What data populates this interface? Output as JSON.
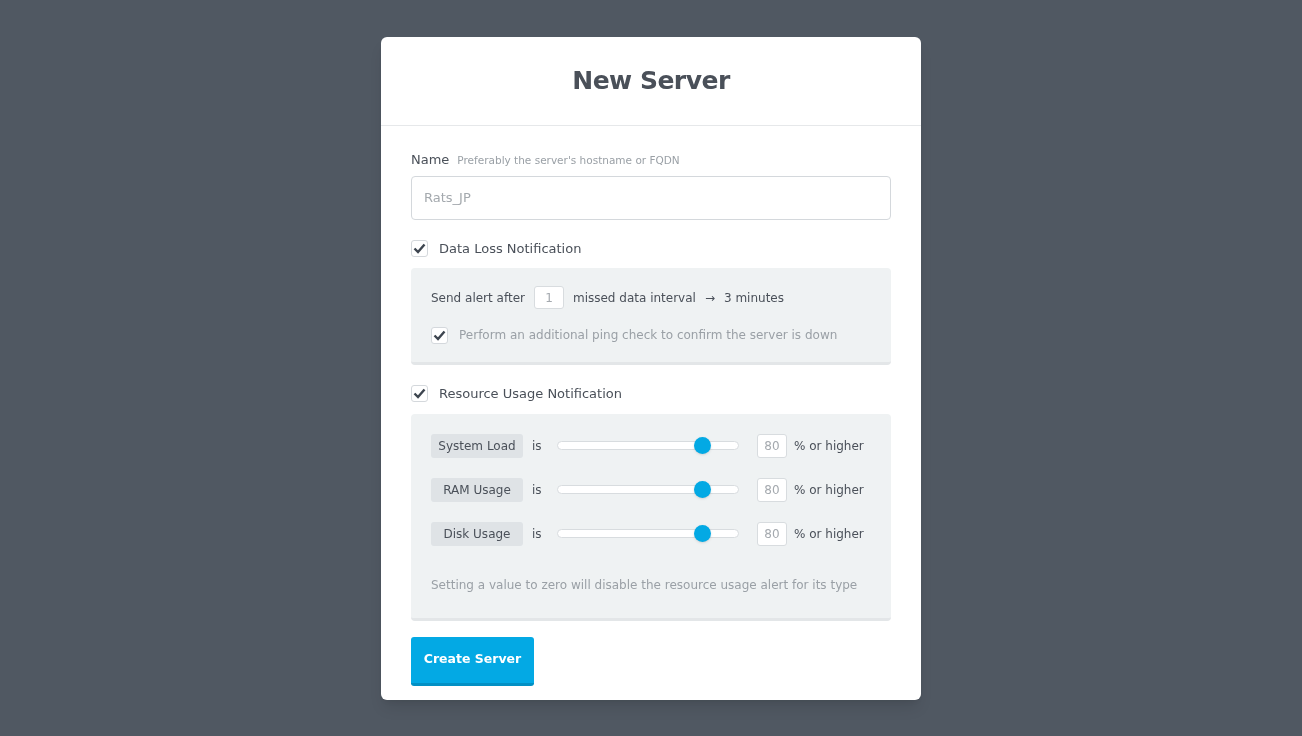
{
  "dialog": {
    "title": "New Server"
  },
  "name_field": {
    "label": "Name",
    "hint": "Preferably the server's hostname or FQDN",
    "placeholder": "Rats_JP"
  },
  "data_loss": {
    "label": "Data Loss Notification",
    "checked": true,
    "prefix": "Send alert after",
    "interval": "1",
    "suffix": "missed data interval",
    "arrow": "→",
    "result": "3 minutes",
    "ping": {
      "label": "Perform an additional ping check to confirm the server is down",
      "checked": true
    }
  },
  "resource_usage": {
    "label": "Resource Usage Notification",
    "checked": true,
    "rows": [
      {
        "name": "System Load",
        "is": "is",
        "level": 0.8,
        "value": "80",
        "unit": "% or higher"
      },
      {
        "name": "RAM Usage",
        "is": "is",
        "level": 0.8,
        "value": "80",
        "unit": "% or higher"
      },
      {
        "name": "Disk Usage",
        "is": "is",
        "level": 0.8,
        "value": "80",
        "unit": "% or higher"
      }
    ],
    "note": "Setting a value to zero will disable the resource usage alert for its type"
  },
  "submit": {
    "label": "Create Server"
  }
}
